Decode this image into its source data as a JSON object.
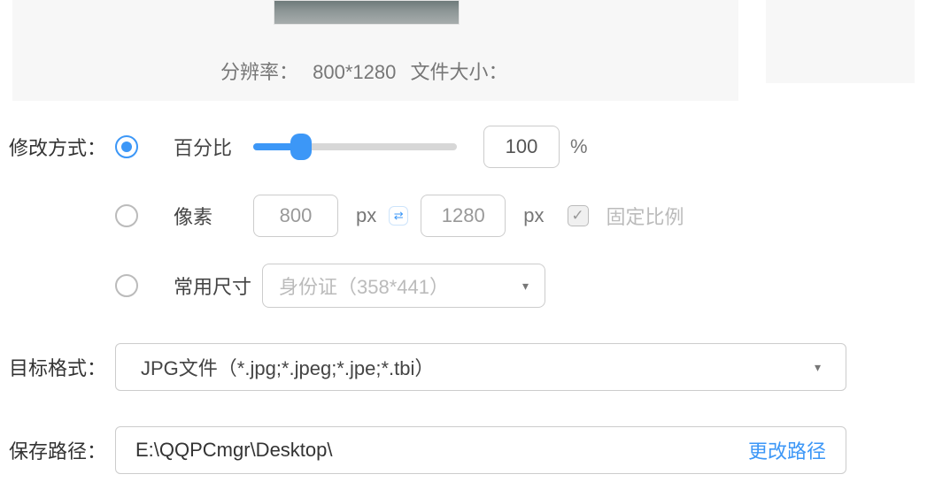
{
  "preview": {
    "resolution_label": "分辨率：",
    "resolution_value": "800*1280",
    "filesize_label": "文件大小："
  },
  "modify": {
    "label": "修改方式：",
    "percent": {
      "label": "百分比",
      "value": "100",
      "unit": "%"
    },
    "pixel": {
      "label": "像素",
      "width": "800",
      "height": "1280",
      "unit": "px",
      "lock_label": "固定比例"
    },
    "common": {
      "label": "常用尺寸",
      "placeholder": "身份证（358*441）"
    }
  },
  "target_format": {
    "label": "目标格式：",
    "value": "JPG文件（*.jpg;*.jpeg;*.jpe;*.tbi）"
  },
  "save_path": {
    "label": "保存路径：",
    "value": "E:\\QQPCmgr\\Desktop\\",
    "change": "更改路径"
  }
}
